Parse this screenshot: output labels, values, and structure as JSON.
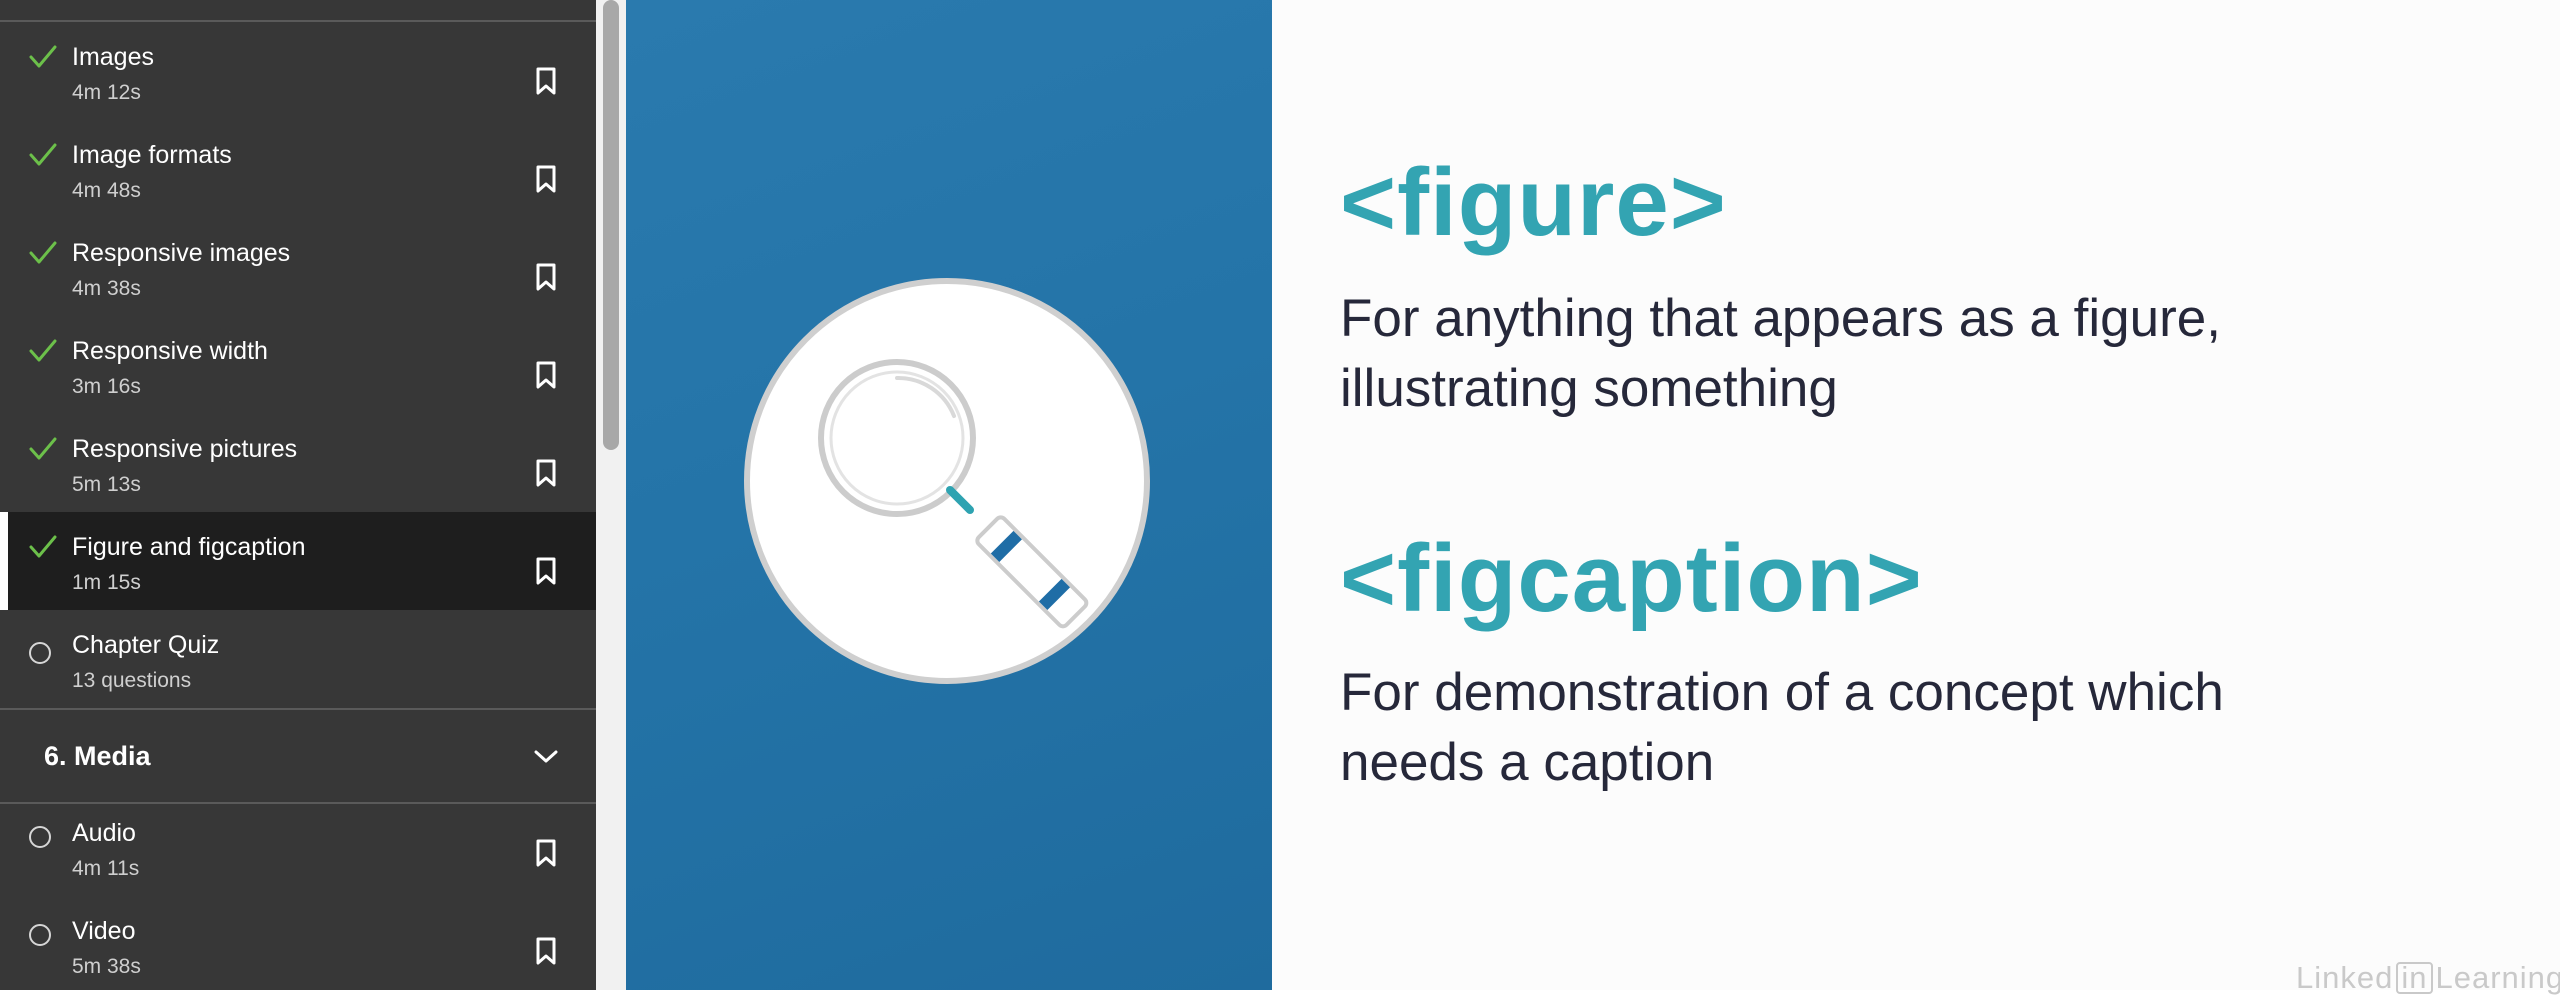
{
  "sidebar": {
    "items": [
      {
        "title": "Images",
        "duration": "4m 12s",
        "status": "completed"
      },
      {
        "title": "Image formats",
        "duration": "4m 48s",
        "status": "completed"
      },
      {
        "title": "Responsive images",
        "duration": "4m 38s",
        "status": "completed"
      },
      {
        "title": "Responsive width",
        "duration": "3m 16s",
        "status": "completed"
      },
      {
        "title": "Responsive pictures",
        "duration": "5m 13s",
        "status": "completed"
      },
      {
        "title": "Figure and figcaption",
        "duration": "1m 15s",
        "status": "completed",
        "active": true
      },
      {
        "title": "Chapter Quiz",
        "duration": "13 questions",
        "status": "not-started"
      }
    ],
    "chapter": {
      "title": "6. Media",
      "icon": "chevron-down-icon",
      "expanded": true
    },
    "chapter_items": [
      {
        "title": "Audio",
        "duration": "4m 11s",
        "status": "not-started"
      },
      {
        "title": "Video",
        "duration": "5m 38s",
        "status": "not-started"
      }
    ],
    "icons": {
      "completed": "check-icon",
      "not_started": "empty-circle-icon",
      "bookmark": "bookmark-icon"
    }
  },
  "slide": {
    "tags": [
      {
        "code": "<figure>",
        "description_lines": [
          "For anything that appears as a figure,",
          "illustrating something"
        ]
      },
      {
        "code": "<figcaption>",
        "description_lines": [
          "For demonstration of a concept which",
          "needs a caption"
        ]
      }
    ],
    "illustration_icon": "magnifying-glass-icon",
    "watermark": {
      "brand_left": "Linked",
      "brand_in": "in",
      "brand_right": "Learning"
    }
  },
  "colors": {
    "sidebar_bg": "#373737",
    "active_bg": "#1e1e1e",
    "check_green": "#6cc04a",
    "slide_blue": "#2474a8",
    "tag_teal": "#33a4b2",
    "text_dark": "#26283a"
  }
}
